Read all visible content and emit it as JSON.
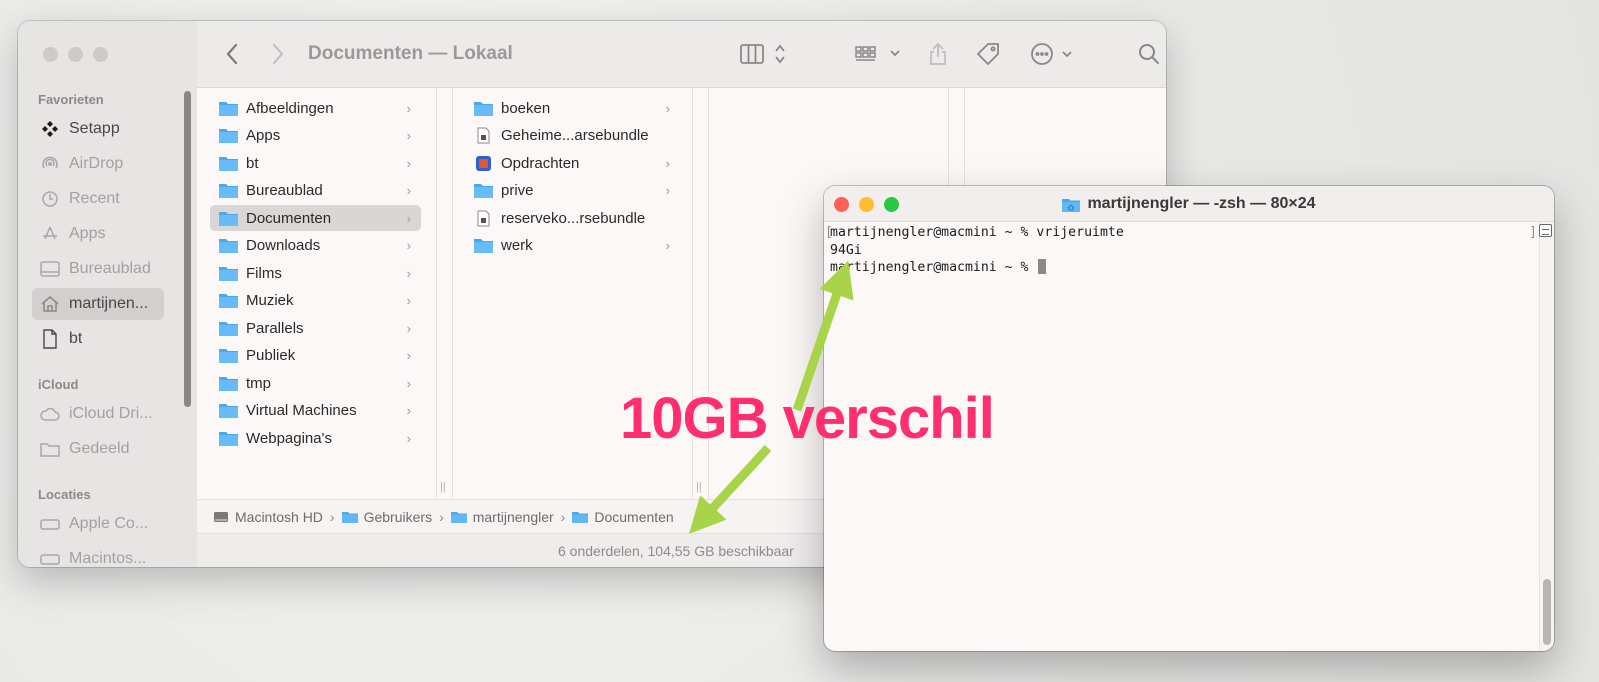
{
  "finder": {
    "title": "Documenten — Lokaal",
    "sidebar": {
      "sections": [
        {
          "label": "Favorieten",
          "items": [
            {
              "label": "Setapp",
              "icon": "setapp-icon"
            },
            {
              "label": "AirDrop",
              "icon": "airdrop-icon"
            },
            {
              "label": "Recent",
              "icon": "clock-icon"
            },
            {
              "label": "Apps",
              "icon": "apps-icon"
            },
            {
              "label": "Bureaublad",
              "icon": "desktop-icon"
            },
            {
              "label": "martijnen...",
              "icon": "home-icon",
              "selected": true
            },
            {
              "label": "bt",
              "icon": "document-icon"
            }
          ]
        },
        {
          "label": "iCloud",
          "items": [
            {
              "label": "iCloud Dri...",
              "icon": "icloud-icon"
            },
            {
              "label": "Gedeeld",
              "icon": "shared-folder-icon"
            }
          ]
        },
        {
          "label": "Locaties",
          "items": [
            {
              "label": "Apple Co...",
              "icon": "drive-icon"
            },
            {
              "label": "Macintos...",
              "icon": "drive-icon"
            }
          ]
        }
      ]
    },
    "column1": [
      {
        "label": "Afbeeldingen",
        "icon": "folder-icon"
      },
      {
        "label": "Apps",
        "icon": "folder-icon"
      },
      {
        "label": "bt",
        "icon": "folder-icon"
      },
      {
        "label": "Bureaublad",
        "icon": "folder-icon"
      },
      {
        "label": "Documenten",
        "icon": "folder-icon",
        "selected": true
      },
      {
        "label": "Downloads",
        "icon": "folder-icon"
      },
      {
        "label": "Films",
        "icon": "folder-icon"
      },
      {
        "label": "Muziek",
        "icon": "folder-icon"
      },
      {
        "label": "Parallels",
        "icon": "folder-icon"
      },
      {
        "label": "Publiek",
        "icon": "folder-icon"
      },
      {
        "label": "tmp",
        "icon": "folder-icon"
      },
      {
        "label": "Virtual Machines",
        "icon": "folder-icon"
      },
      {
        "label": "Webpagina's",
        "icon": "folder-icon"
      }
    ],
    "column2": [
      {
        "label": "boeken",
        "icon": "folder-icon",
        "chevron": true
      },
      {
        "label": "Geheime...arsebundle",
        "icon": "sparsebundle-icon",
        "chevron": false
      },
      {
        "label": "Opdrachten",
        "icon": "app-folder-icon",
        "chevron": true
      },
      {
        "label": "prive",
        "icon": "folder-icon",
        "chevron": true
      },
      {
        "label": "reserveko...rsebundle",
        "icon": "sparsebundle-icon",
        "chevron": false
      },
      {
        "label": "werk",
        "icon": "folder-icon",
        "chevron": true
      }
    ],
    "pathbar": [
      "Macintosh HD",
      "Gebruikers",
      "martijnengler",
      "Documenten"
    ],
    "status": "6 onderdelen, 104,55 GB beschikbaar"
  },
  "terminal": {
    "title": "martijnengler — -zsh — 80×24",
    "lines": [
      "martijnengler@macmini ~ % vrijeruimte",
      "94Gi",
      "martijnengler@macmini ~ % "
    ]
  },
  "annotation": {
    "text": "10GB verschil",
    "color": "#ff2e6f",
    "arrow_color": "#a8d44a"
  }
}
